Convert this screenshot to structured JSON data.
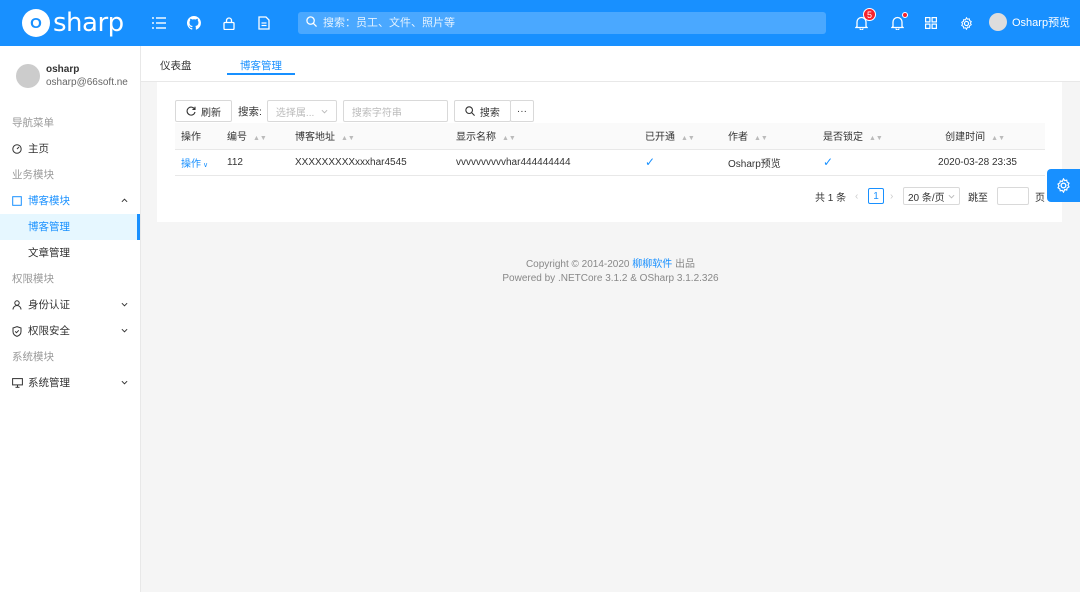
{
  "app": {
    "logo_letter": "O",
    "logo_text": "sharp",
    "search_placeholder": "搜索：员工、文件、照片等",
    "notification_count": "5",
    "user_name": "Osharp预览"
  },
  "sidebar": {
    "profile": {
      "name": "osharp",
      "email": "osharp@66soft.ne"
    },
    "groups": [
      {
        "label": "导航菜单"
      },
      {
        "label": "业务模块"
      },
      {
        "label": "权限模块"
      },
      {
        "label": "系统模块"
      }
    ],
    "items": {
      "home": "主页",
      "blog_module": "博客模块",
      "blog_manage": "博客管理",
      "article_manage": "文章管理",
      "identity": "身份认证",
      "security": "权限安全",
      "system": "系统管理"
    }
  },
  "tabs": [
    {
      "label": "仪表盘"
    },
    {
      "label": "博客管理"
    }
  ],
  "toolbar": {
    "refresh": "刷新",
    "search_label": "搜索:",
    "select_placeholder": "选择属...",
    "input_placeholder": "搜索字符串",
    "search_button": "搜索",
    "more": "···"
  },
  "table": {
    "columns": [
      "操作",
      "编号",
      "博客地址",
      "显示名称",
      "已开通",
      "作者",
      "是否锁定",
      "创建时间"
    ],
    "rows": [
      {
        "action": "操作",
        "id": "112",
        "url": "XXXXXXXXXxxxhar4545",
        "display_name": "vvvvvvvvvvhar444444444",
        "enabled_mark": "✓",
        "author": "Osharp预览",
        "locked_mark": "✓",
        "created": "2020-03-28 23:35"
      }
    ]
  },
  "pagination": {
    "total": "共 1 条",
    "current_page": "1",
    "page_size": "20 条/页",
    "jump_label": "跳至",
    "page_suffix": "页"
  },
  "footer": {
    "copyright_prefix": "Copyright © 2014-2020",
    "company": "柳柳软件",
    "copyright_suffix": "出品",
    "powered": "Powered by .NETCore 3.1.2 & OSharp 3.1.2.326"
  },
  "colors": {
    "primary": "#1890ff",
    "badge": "#f5222d"
  }
}
